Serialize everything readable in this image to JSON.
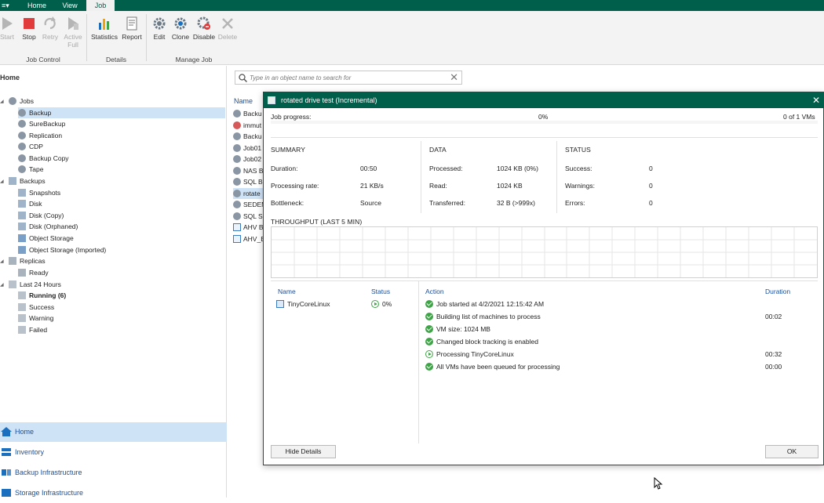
{
  "ribbon_tabs": {
    "menu": "≡▾",
    "home": "Home",
    "view": "View",
    "job": "Job"
  },
  "ribbon": {
    "buttons": {
      "start": "Start",
      "stop": "Stop",
      "retry": "Retry",
      "active_full_1": "Active",
      "active_full_2": "Full",
      "statistics": "Statistics",
      "report": "Report",
      "edit": "Edit",
      "clone": "Clone",
      "disable": "Disable",
      "delete": "Delete"
    },
    "groups": {
      "job_control": "Job Control",
      "details": "Details",
      "manage_job": "Manage Job"
    }
  },
  "left": {
    "title": "Home",
    "tree": {
      "jobs": "Jobs",
      "backup": "Backup",
      "surebackup": "SureBackup",
      "replication": "Replication",
      "cdp": "CDP",
      "backup_copy": "Backup Copy",
      "tape": "Tape",
      "backups": "Backups",
      "snapshots": "Snapshots",
      "disk": "Disk",
      "disk_copy": "Disk (Copy)",
      "disk_orphaned": "Disk (Orphaned)",
      "object_storage": "Object Storage",
      "object_storage_imported": "Object Storage (Imported)",
      "replicas": "Replicas",
      "ready": "Ready",
      "last_24": "Last 24 Hours",
      "running": "Running (6)",
      "success": "Success",
      "warning": "Warning",
      "failed": "Failed"
    },
    "nav": {
      "home": "Home",
      "inventory": "Inventory",
      "backup_infra": "Backup Infrastructure",
      "storage_infra": "Storage Infrastructure"
    }
  },
  "main": {
    "search_placeholder": "Type in an object name to search for",
    "col_name": "Name",
    "jobs": [
      "Backu",
      "immut",
      "Backu",
      "Job01",
      "Job02",
      "NAS B",
      "SQL B",
      "rotate",
      "SEDEM",
      "SQL S",
      "AHV B",
      "AHV_B"
    ]
  },
  "dialog": {
    "title": "rotated drive test (Incremental)",
    "job_progress_label": "Job progress:",
    "progress_percent": "0%",
    "progress_fraction": 0,
    "vms_count": "0 of 1 VMs",
    "summary": {
      "heading": "SUMMARY",
      "duration_label": "Duration:",
      "duration": "00:50",
      "rate_label": "Processing rate:",
      "rate": "21 KB/s",
      "bottleneck_label": "Bottleneck:",
      "bottleneck": "Source"
    },
    "data": {
      "heading": "DATA",
      "processed_label": "Processed:",
      "processed": "1024 KB (0%)",
      "read_label": "Read:",
      "read": "1024 KB",
      "transferred_label": "Transferred:",
      "transferred": "32 B (>999x)"
    },
    "status": {
      "heading": "STATUS",
      "success_label": "Success:",
      "success": "0",
      "warnings_label": "Warnings:",
      "warnings": "0",
      "errors_label": "Errors:",
      "errors": "0"
    },
    "throughput_heading": "THROUGHPUT (LAST 5 MIN)",
    "vm_table": {
      "col_name": "Name",
      "col_status": "Status",
      "vm_name": "TinyCoreLinux",
      "vm_status": "0%"
    },
    "action_table": {
      "col_action": "Action",
      "col_duration": "Duration",
      "rows": [
        {
          "icon": "check-icon",
          "text": "Job started at 4/2/2021 12:15:42 AM",
          "duration": ""
        },
        {
          "icon": "check-icon",
          "text": "Building list of machines to process",
          "duration": "00:02"
        },
        {
          "icon": "check-icon",
          "text": "VM size: 1024 MB",
          "duration": ""
        },
        {
          "icon": "check-icon",
          "text": "Changed block tracking is enabled",
          "duration": ""
        },
        {
          "icon": "play-icon",
          "text": "Processing TinyCoreLinux",
          "duration": "00:32"
        },
        {
          "icon": "check-icon",
          "text": "All VMs have been queued for processing",
          "duration": "00:00"
        }
      ]
    },
    "hide_details": "Hide Details",
    "ok": "OK"
  },
  "colors": {
    "brand_green": "#005f4b",
    "selection_blue": "#cfe3f7",
    "link_blue": "#1b4f9c",
    "success_green": "#3fa447",
    "stop_red": "#e23b3b"
  }
}
